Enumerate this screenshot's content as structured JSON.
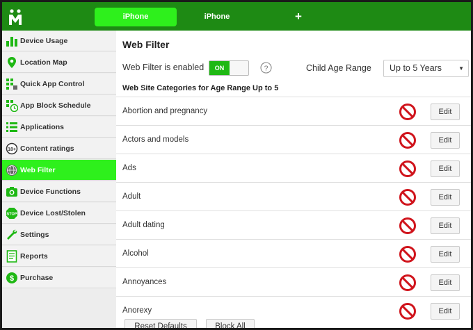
{
  "header": {
    "tabs": [
      {
        "label": "iPhone",
        "active": true
      },
      {
        "label": "iPhone",
        "active": false
      }
    ],
    "add_label": "+"
  },
  "sidebar": {
    "items": [
      {
        "label": "Device Usage",
        "icon": "bar-chart-icon"
      },
      {
        "label": "Location Map",
        "icon": "map-pin-icon"
      },
      {
        "label": "Quick App Control",
        "icon": "app-grid-icon"
      },
      {
        "label": "App Block Schedule",
        "icon": "schedule-icon"
      },
      {
        "label": "Applications",
        "icon": "list-icon"
      },
      {
        "label": "Content ratings",
        "icon": "rating-icon"
      },
      {
        "label": "Web Filter",
        "icon": "globe-icon",
        "active": true
      },
      {
        "label": "Device Functions",
        "icon": "camera-icon"
      },
      {
        "label": "Device Lost/Stolen",
        "icon": "stop-icon"
      },
      {
        "label": "Settings",
        "icon": "wrench-icon"
      },
      {
        "label": "Reports",
        "icon": "report-icon"
      },
      {
        "label": "Purchase",
        "icon": "dollar-icon"
      }
    ]
  },
  "main": {
    "title": "Web Filter",
    "enabled_label": "Web Filter is enabled",
    "toggle_label": "ON",
    "age_label": "Child Age Range",
    "age_value": "Up to 5 Years",
    "categories_heading": "Web Site Categories for Age Range Up to 5",
    "categories": [
      {
        "name": "Abortion and pregnancy",
        "edit": "Edit"
      },
      {
        "name": "Actors and models",
        "edit": "Edit"
      },
      {
        "name": "Ads",
        "edit": "Edit"
      },
      {
        "name": "Adult",
        "edit": "Edit"
      },
      {
        "name": "Adult dating",
        "edit": "Edit"
      },
      {
        "name": "Alcohol",
        "edit": "Edit"
      },
      {
        "name": "Annoyances",
        "edit": "Edit"
      },
      {
        "name": "Anorexy",
        "edit": "Edit"
      }
    ],
    "reset_label": "Reset Defaults",
    "block_all_label": "Block All"
  },
  "colors": {
    "brand_green": "#1e8a14",
    "active_green": "#2ef01c",
    "block_red": "#d0141c"
  }
}
